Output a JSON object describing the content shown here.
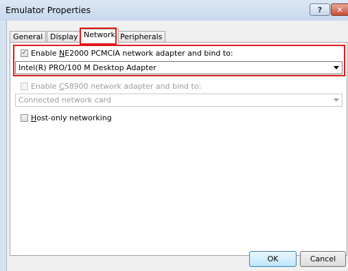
{
  "window": {
    "title": "Emulator Properties",
    "help_glyph": "?",
    "close_glyph": "✕"
  },
  "tabs": [
    {
      "label": "General",
      "active": false
    },
    {
      "label": "Display",
      "active": false
    },
    {
      "label": "Network",
      "active": true
    },
    {
      "label": "Peripherals",
      "active": false
    }
  ],
  "network": {
    "ne2000": {
      "checked": true,
      "check_glyph": "✓",
      "label_pre": "Enable ",
      "label_access": "N",
      "label_post": "E2000 PCMCIA network adapter and bind to:",
      "selected": "Intel(R) PRO/100 M Desktop Adapter",
      "enabled": true
    },
    "cs8900": {
      "checked": false,
      "label_pre": "Enable ",
      "label_access": "C",
      "label_post": "S8900 network adapter and bind to:",
      "selected": "Connected network card",
      "enabled": false
    },
    "host_only": {
      "checked": false,
      "label_access": "H",
      "label_post": "ost-only networking"
    }
  },
  "buttons": {
    "ok": "OK",
    "cancel": "Cancel"
  },
  "colors": {
    "highlight": "#e01818",
    "title_bg": "#d6e3f1"
  }
}
